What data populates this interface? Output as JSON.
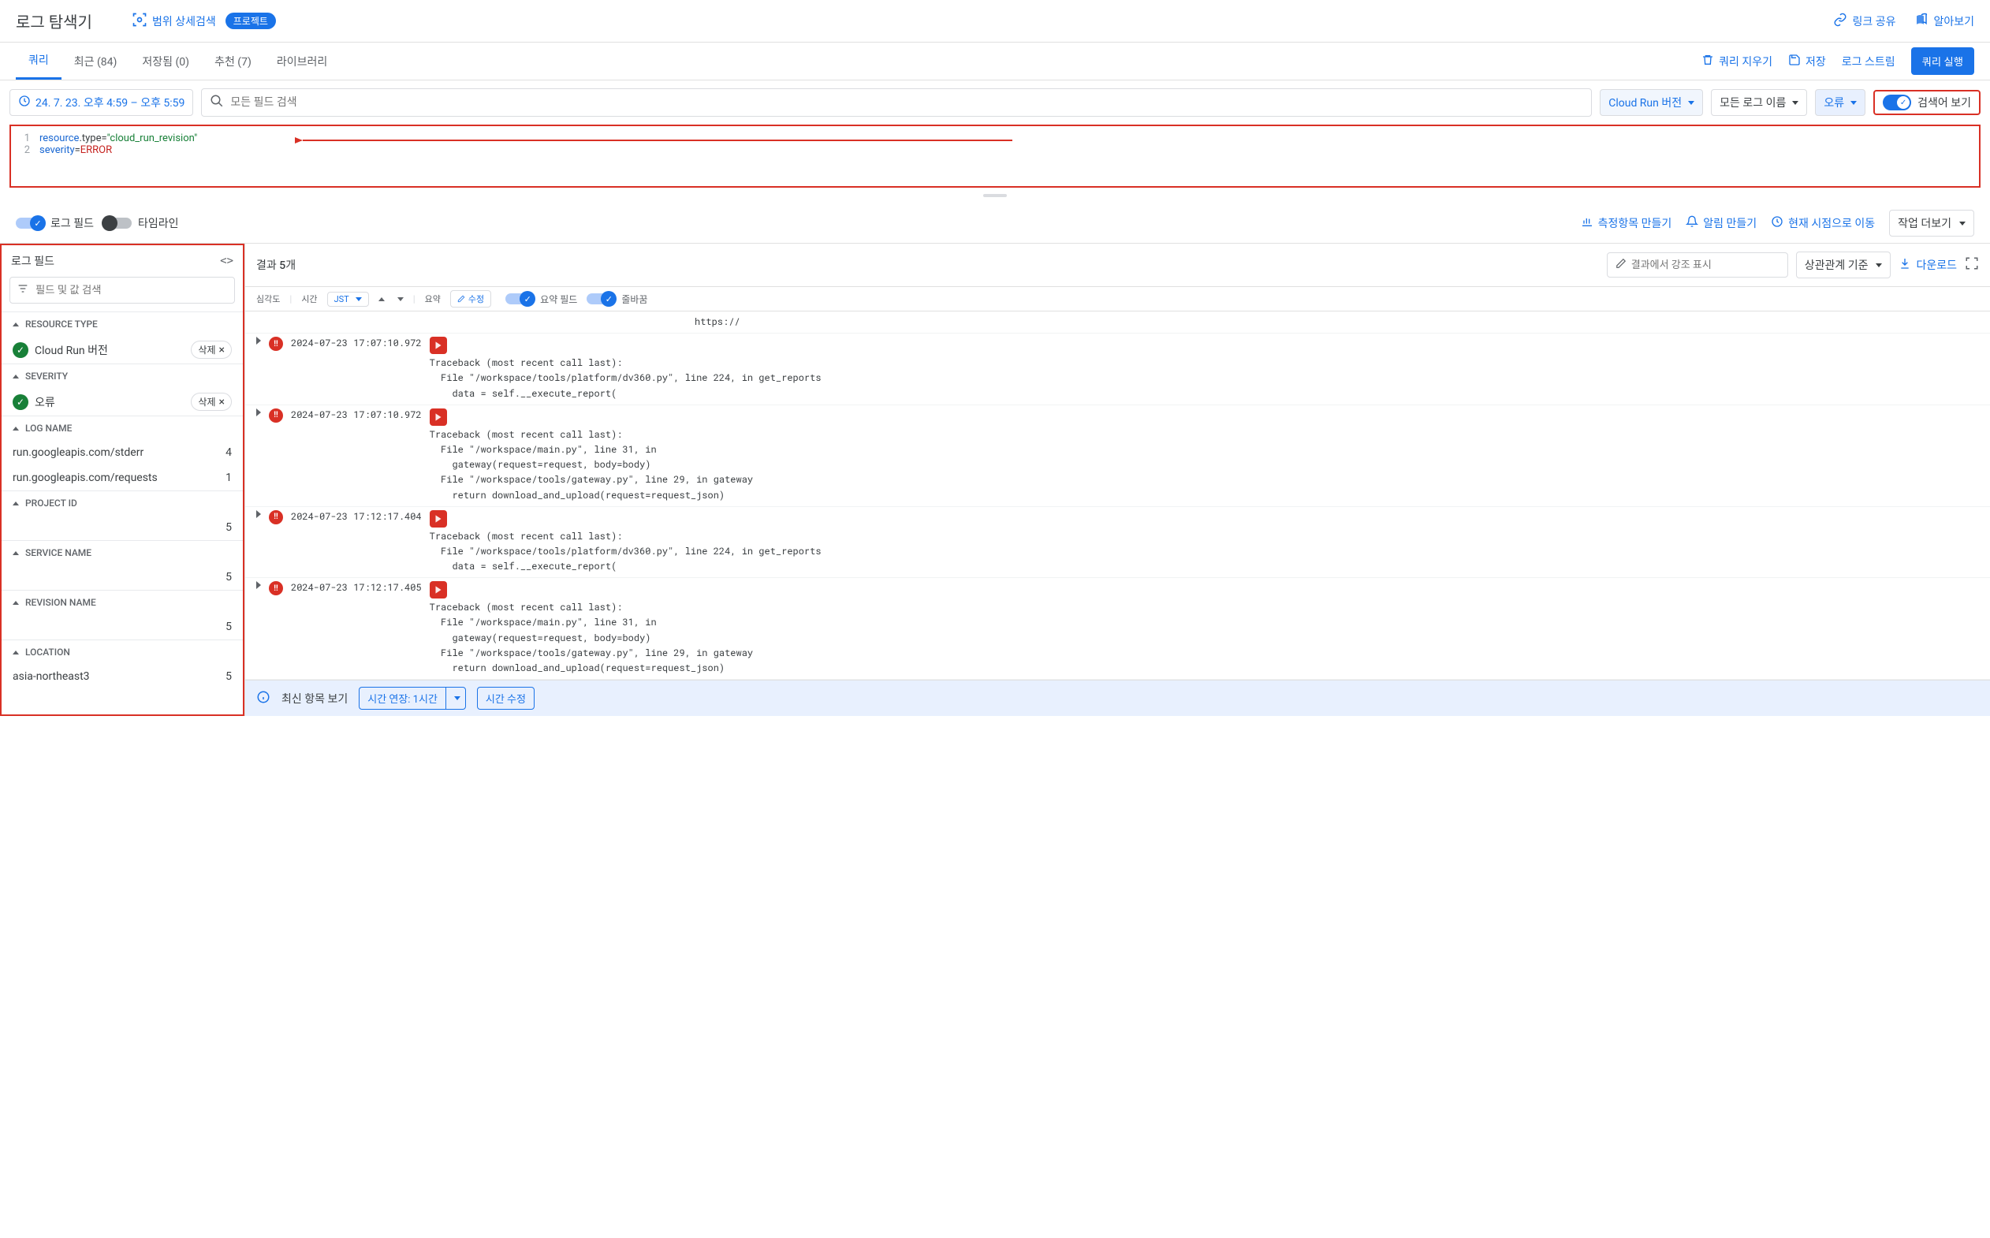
{
  "header": {
    "title": "로그 탐색기",
    "scopeSearch": "범위 상세검색",
    "scopePill": "프로젝트",
    "linkShare": "링크 공유",
    "learn": "알아보기"
  },
  "tabs": {
    "items": [
      {
        "label": "쿼리",
        "active": true
      },
      {
        "label": "최근 (84)",
        "active": false
      },
      {
        "label": "저장됨 (0)",
        "active": false
      },
      {
        "label": "추천 (7)",
        "active": false
      },
      {
        "label": "라이브러리",
        "active": false
      }
    ],
    "clearQuery": "쿼리 지우기",
    "save": "저장",
    "logStream": "로그 스트림",
    "runQuery": "쿼리 실행"
  },
  "filterRow": {
    "timeRange": "24. 7. 23. 오후 4:59 – 오후 5:59",
    "searchPlaceholder": "모든 필드 검색",
    "cloudRunVersion": "Cloud Run 버전",
    "allLogNames": "모든 로그 이름",
    "error": "오류",
    "showQuery": "검색어 보기"
  },
  "query": {
    "lines": [
      {
        "num": "1",
        "parts": [
          [
            "kw",
            "resource"
          ],
          [
            "",
            ".type="
          ],
          [
            "str",
            "\"cloud_run_revision\""
          ]
        ]
      },
      {
        "num": "2",
        "parts": [
          [
            "kw",
            "severity"
          ],
          [
            "",
            "="
          ],
          [
            "val",
            "ERROR"
          ]
        ]
      }
    ]
  },
  "midControls": {
    "logFields": "로그 필드",
    "timeline": "타임라인",
    "createMetric": "측정항목 만들기",
    "createAlert": "알림 만들기",
    "jumpNow": "현재 시점으로 이동",
    "moreActions": "작업 더보기"
  },
  "leftPanel": {
    "title": "로그 필드",
    "searchPlaceholder": "필드 및 값 검색",
    "sections": {
      "resourceType": {
        "header": "RESOURCE TYPE",
        "items": [
          {
            "label": "Cloud Run 버전",
            "remove": "삭제"
          }
        ]
      },
      "severity": {
        "header": "SEVERITY",
        "items": [
          {
            "label": "오류",
            "remove": "삭제"
          }
        ]
      },
      "logName": {
        "header": "LOG NAME",
        "items": [
          {
            "label": "run.googleapis.com/stderr",
            "count": "4"
          },
          {
            "label": "run.googleapis.com/requests",
            "count": "1"
          }
        ]
      },
      "projectId": {
        "header": "PROJECT ID",
        "items": [
          {
            "label": "",
            "count": "5"
          }
        ]
      },
      "serviceName": {
        "header": "SERVICE NAME",
        "items": [
          {
            "label": "",
            "count": "5"
          }
        ]
      },
      "revisionName": {
        "header": "REVISION NAME",
        "items": [
          {
            "label": "",
            "count": "5"
          }
        ]
      },
      "location": {
        "header": "LOCATION",
        "items": [
          {
            "label": "asia-northeast3",
            "count": "5"
          }
        ]
      }
    }
  },
  "results": {
    "countLabel": "결과 5개",
    "highlightPlaceholder": "결과에서 강조 표시",
    "correlate": "상관관계 기준",
    "download": "다운로드",
    "cols": {
      "severity": "심각도",
      "time": "시간",
      "jst": "JST",
      "summary": "요약",
      "edit": "수정",
      "summaryFields": "요약 필드",
      "wrap": "줄바꿈"
    },
    "firstRowTail": "https://",
    "entries": [
      {
        "ts": "2024-07-23 17:07:10.972",
        "msg": "Traceback (most recent call last):\n  File \"/workspace/tools/platform/dv360.py\", line 224, in get_reports\n    data = self.__execute_report("
      },
      {
        "ts": "2024-07-23 17:07:10.972",
        "msg": "Traceback (most recent call last):\n  File \"/workspace/main.py\", line 31, in\n    gateway(request=request, body=body)\n  File \"/workspace/tools/gateway.py\", line 29, in gateway\n    return download_and_upload(request=request_json)"
      },
      {
        "ts": "2024-07-23 17:12:17.404",
        "msg": "Traceback (most recent call last):\n  File \"/workspace/tools/platform/dv360.py\", line 224, in get_reports\n    data = self.__execute_report("
      },
      {
        "ts": "2024-07-23 17:12:17.405",
        "msg": "Traceback (most recent call last):\n  File \"/workspace/main.py\", line 31, in\n    gateway(request=request, body=body)\n  File \"/workspace/tools/gateway.py\", line 29, in gateway\n    return download_and_upload(request=request_json)"
      }
    ]
  },
  "bottomBar": {
    "viewLatest": "최신 항목 보기",
    "extend": "시간 연장: 1시간",
    "editTime": "시간 수정"
  }
}
